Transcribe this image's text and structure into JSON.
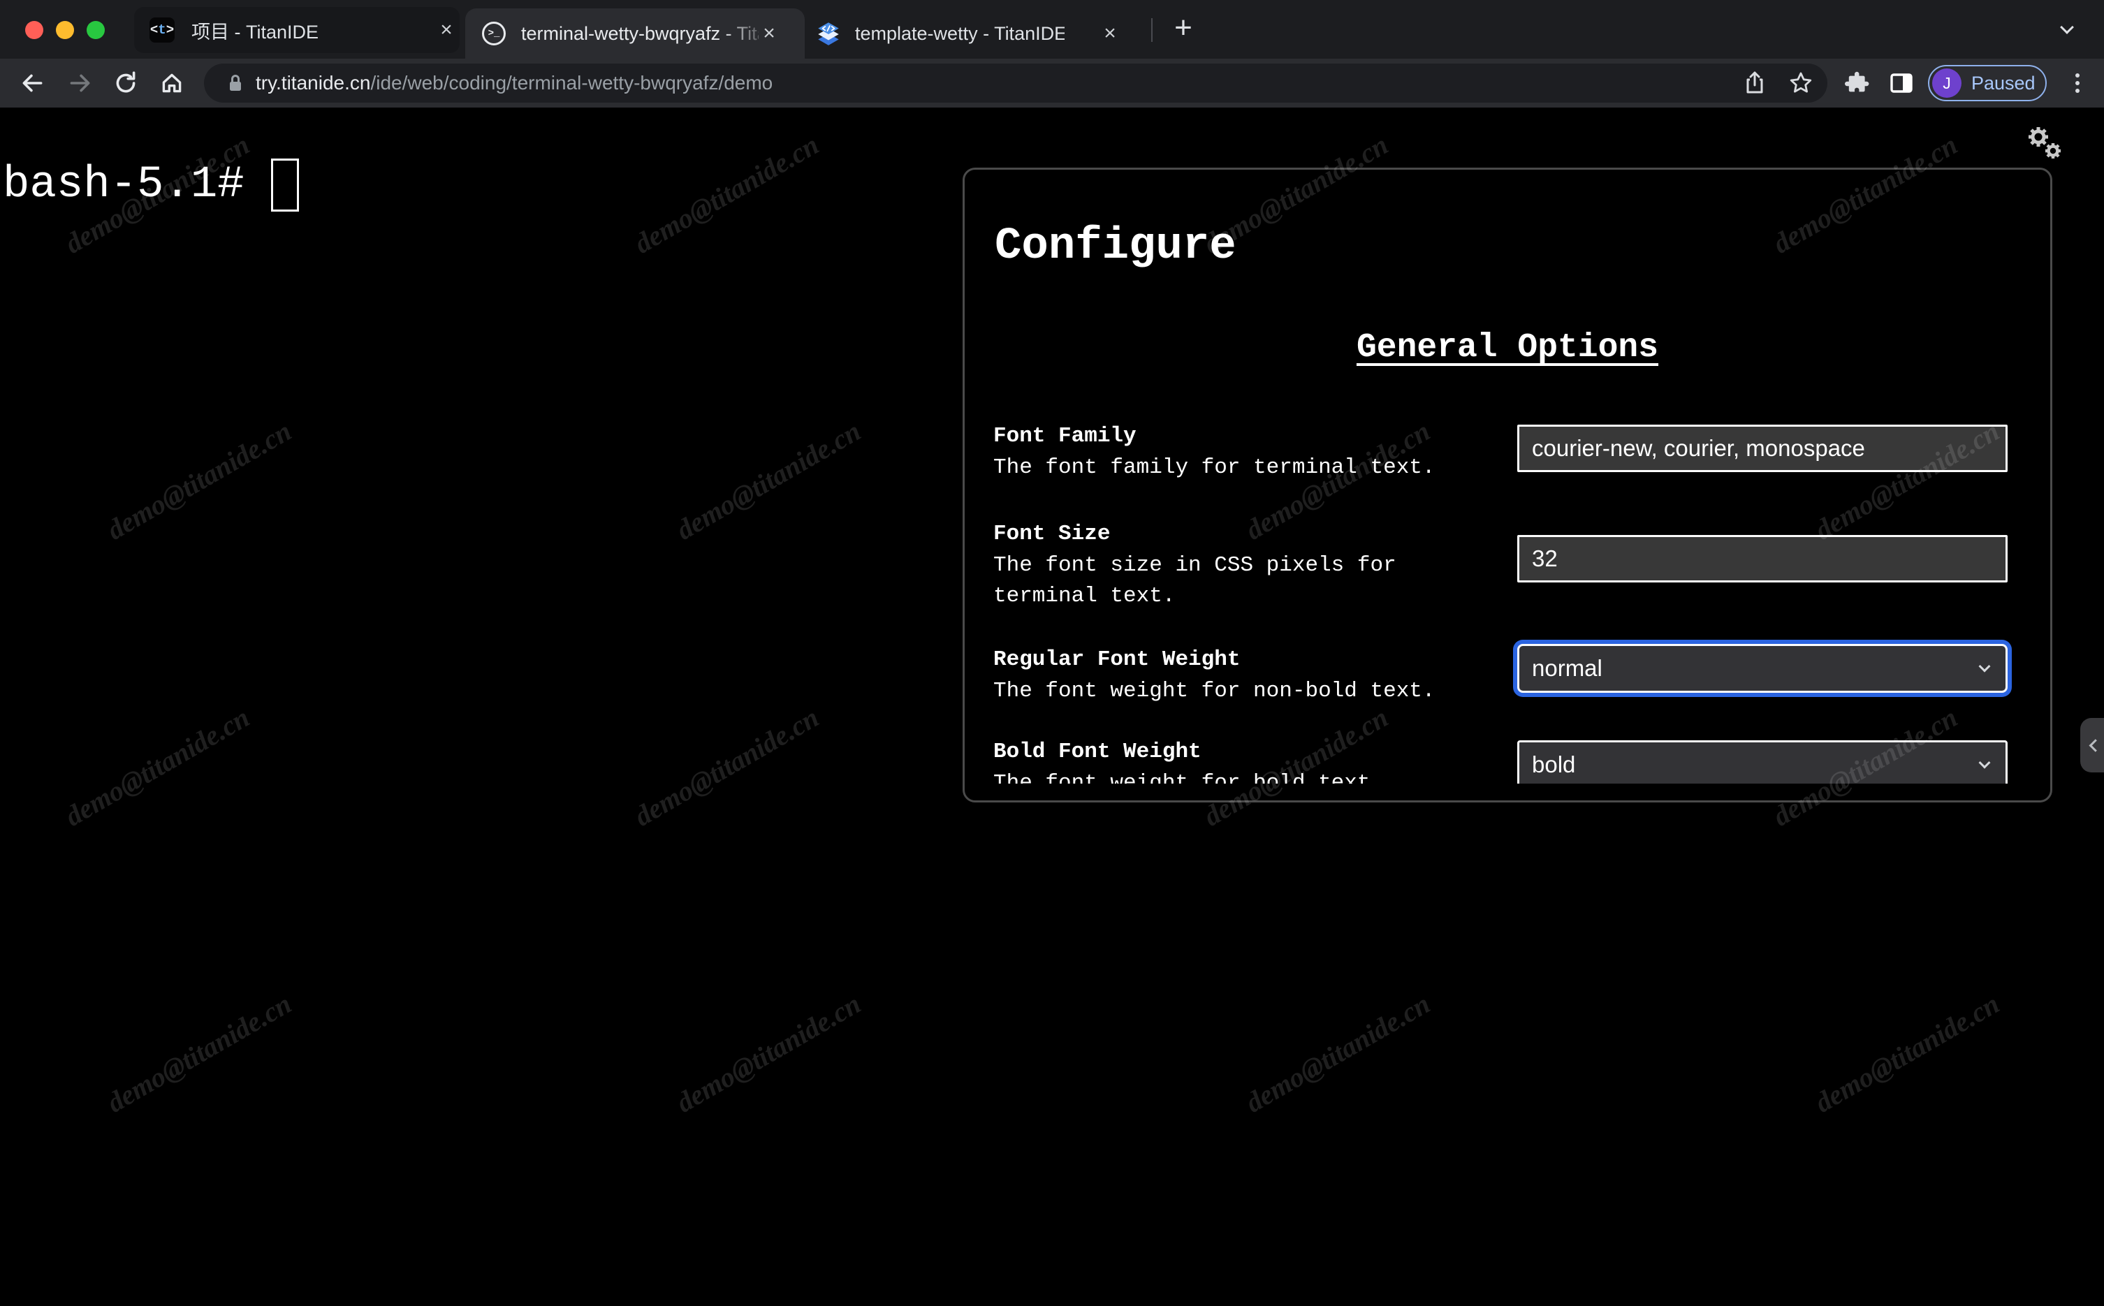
{
  "browser": {
    "tabs": [
      {
        "title": "项目 - TitanIDE",
        "favicon": {
          "open": "<",
          "letter": "t",
          "close": ">"
        }
      },
      {
        "title": "terminal-wetty-bwqryafz - Tita",
        "favicon_glyph": ">_"
      },
      {
        "title": "template-wetty - TitanIDE"
      }
    ],
    "close_glyph": "×",
    "new_tab_glyph": "+",
    "url": {
      "host": "try.titanide.cn",
      "path": "/ide/web/coding/terminal-wetty-bwqryafz/demo"
    },
    "profile": {
      "initial": "J",
      "status": "Paused"
    }
  },
  "terminal": {
    "prompt": "bash-5.1#"
  },
  "configure": {
    "title": "Configure",
    "section_heading": "General Options",
    "fields": [
      {
        "label": "Font Family",
        "description": "The font family for terminal text.",
        "value": "courier-new, courier, monospace",
        "type": "input"
      },
      {
        "label": "Font Size",
        "description": "The font size in CSS pixels for terminal text.",
        "value": "32",
        "type": "input"
      },
      {
        "label": "Regular Font Weight",
        "description": "The font weight for non-bold text.",
        "value": "normal",
        "type": "select",
        "focused": true
      },
      {
        "label": "Bold Font Weight",
        "description": "The font weight for bold text.",
        "value": "bold",
        "type": "select"
      }
    ]
  },
  "watermark": {
    "text": "demo@titanide.cn"
  },
  "colors": {
    "focus_ring": "#2b64e0",
    "avatar": "#6e41cd",
    "paused_text": "#a8c7fa",
    "toolbar": "#2b2c30",
    "tabstrip": "#1c1d20",
    "terminal_bg": "#000000"
  }
}
